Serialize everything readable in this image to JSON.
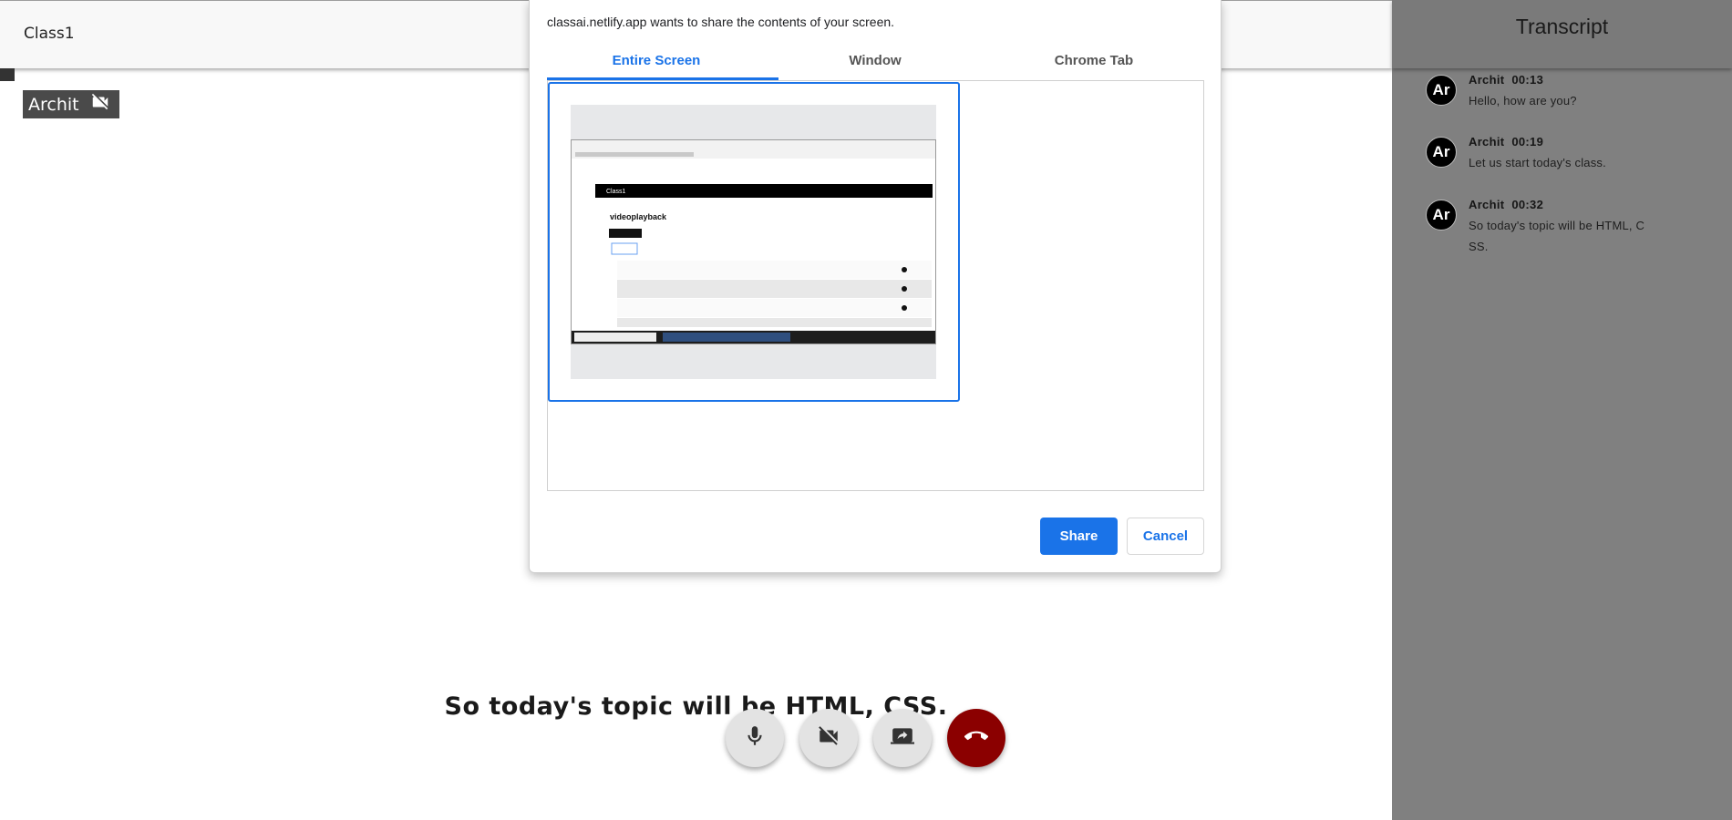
{
  "app": {
    "class_title": "Class1"
  },
  "participant": {
    "name": "Archit",
    "camera_icon": "videocam-off-icon"
  },
  "dialog": {
    "prompt": "classai.netlify.app wants to share the contents of your screen.",
    "tabs": [
      {
        "label": "Entire Screen",
        "active": true
      },
      {
        "label": "Window",
        "active": false
      },
      {
        "label": "Chrome Tab",
        "active": false
      }
    ],
    "thumbnail": {
      "app_bar_label": "Class1",
      "heading": "videoplayback"
    },
    "share_label": "Share",
    "cancel_label": "Cancel",
    "accent_color": "#1a73e8"
  },
  "transcript": {
    "title": "Transcript",
    "messages": [
      {
        "avatar": "Ar",
        "name": "Archit",
        "time": "00:13",
        "text": "Hello, how are you?"
      },
      {
        "avatar": "Ar",
        "name": "Archit",
        "time": "00:19",
        "text": "Let us start today's class."
      },
      {
        "avatar": "Ar",
        "name": "Archit",
        "time": "00:32",
        "text": "So today's topic will be HTML, C SS."
      }
    ]
  },
  "caption": "So today's topic will be HTML, CSS.",
  "controls": {
    "mic_icon": "microphone-icon",
    "camera_icon": "videocam-off-icon",
    "share_icon": "screen-share-icon",
    "end_icon": "call-end-icon",
    "end_color": "#8b0000"
  }
}
